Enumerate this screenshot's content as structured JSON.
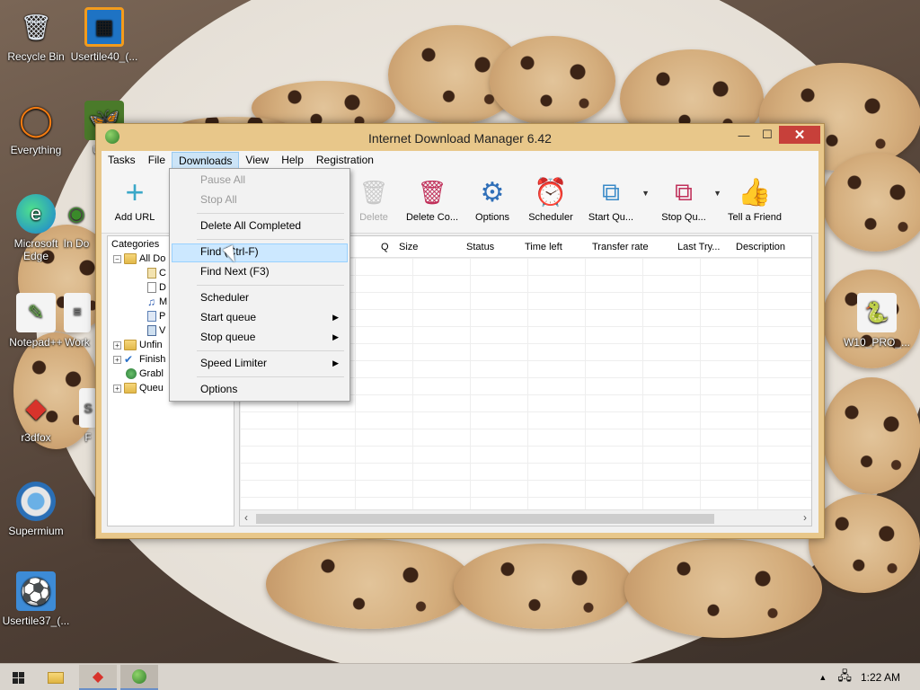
{
  "desktop": {
    "icons": [
      {
        "label": "Recycle Bin",
        "icon": "recycle-bin-icon"
      },
      {
        "label": "Usertile40_(...",
        "icon": "usertile-icon"
      },
      {
        "label": "Everything",
        "icon": "everything-icon"
      },
      {
        "label": "User",
        "icon": "butterfly-icon"
      },
      {
        "label": "Microsoft Edge",
        "icon": "edge-icon"
      },
      {
        "label": "In Do",
        "icon": "idm-icon"
      },
      {
        "label": "Notepad++",
        "icon": "notepadpp-icon"
      },
      {
        "label": "Work",
        "icon": "file-icon"
      },
      {
        "label": "r3dfox",
        "icon": "r3dfox-icon"
      },
      {
        "label": "F",
        "icon": "file-icon"
      },
      {
        "label": "Supermium",
        "icon": "supermium-icon"
      },
      {
        "label": "Usertile37_(...",
        "icon": "soccer-ball-icon"
      },
      {
        "label": "W10_PRO_...",
        "icon": "python-icon"
      }
    ]
  },
  "window": {
    "title": "Internet Download Manager 6.42",
    "minimize": "—",
    "maximize": "☐",
    "close": "✕"
  },
  "menubar": {
    "items": [
      "Tasks",
      "File",
      "Downloads",
      "View",
      "Help",
      "Registration"
    ],
    "active": "Downloads"
  },
  "toolbar": {
    "add_url": "Add URL",
    "delete": "Delete",
    "delete_completed": "Delete Co...",
    "options": "Options",
    "scheduler": "Scheduler",
    "start_queue": "Start Qu...",
    "stop_queue": "Stop Qu...",
    "tell_friend": "Tell a Friend"
  },
  "categories": {
    "header": "Categories",
    "items": [
      "All Do",
      "C",
      "D",
      "M",
      "P",
      "V",
      "Unfin",
      "Finish",
      "Grabl",
      "Queu"
    ]
  },
  "list": {
    "columns": [
      "Q",
      "Size",
      "Status",
      "Time left",
      "Transfer rate",
      "Last Try...",
      "Description"
    ]
  },
  "downloads_menu": {
    "pause_all": "Pause All",
    "stop_all": "Stop All",
    "delete_all_completed": "Delete All Completed",
    "find": "Find (Ctrl-F)",
    "find_next": "Find Next (F3)",
    "scheduler": "Scheduler",
    "start_queue": "Start queue",
    "stop_queue": "Stop queue",
    "speed_limiter": "Speed Limiter",
    "options": "Options"
  },
  "taskbar": {
    "clock": "1:22 AM"
  }
}
